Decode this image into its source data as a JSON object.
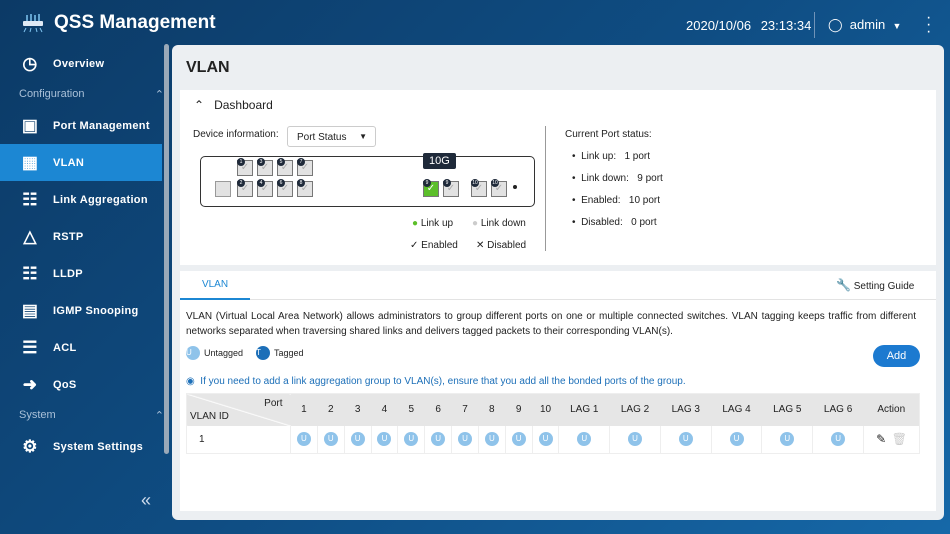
{
  "header": {
    "title": "QSS Management",
    "date": "2020/10/06",
    "time": "23:13:34",
    "user": "admin"
  },
  "sidebar": {
    "overview": "Overview",
    "section_config": "Configuration",
    "items": [
      {
        "label": "Port Management",
        "icon": "port-icon"
      },
      {
        "label": "VLAN",
        "icon": "vlan-icon",
        "active": true
      },
      {
        "label": "Link Aggregation",
        "icon": "link-aggregation-icon"
      },
      {
        "label": "RSTP",
        "icon": "rstp-icon"
      },
      {
        "label": "LLDP",
        "icon": "lldp-icon"
      },
      {
        "label": "IGMP Snooping",
        "icon": "igmp-icon"
      },
      {
        "label": "ACL",
        "icon": "acl-icon"
      },
      {
        "label": "QoS",
        "icon": "qos-icon"
      }
    ],
    "section_system": "System",
    "system_settings": "System Settings"
  },
  "page": {
    "title": "VLAN"
  },
  "dashboard": {
    "title": "Dashboard",
    "device_info_label": "Device information:",
    "device_info_value": "Port Status",
    "tooltip": "10G",
    "ports_top": [
      "1",
      "3",
      "5",
      "7"
    ],
    "ports_bottom": [
      "2",
      "4",
      "6",
      "8"
    ],
    "ports_right": [
      "9",
      "9",
      "10",
      "10"
    ],
    "legend": {
      "link_up": "Link up",
      "link_down": "Link down",
      "enabled": "Enabled",
      "disabled": "Disabled"
    },
    "status_title": "Current Port status:",
    "status": [
      {
        "label": "Link up:",
        "value": "1 port"
      },
      {
        "label": "Link down:",
        "value": "9 port"
      },
      {
        "label": "Enabled:",
        "value": "10 port"
      },
      {
        "label": "Disabled:",
        "value": "0 port"
      }
    ],
    "colors": {
      "link_up": "#5cbf2a",
      "link_down": "#cccccc"
    }
  },
  "vlan": {
    "tab": "VLAN",
    "setting_guide": "Setting Guide",
    "description": "VLAN (Virtual Local Area Network) allows administrators to group different ports on one or multiple connected switches. VLAN tagging keeps traffic from different networks separated when traversing shared links and delivers tagged packets to their corresponding VLAN(s).",
    "untagged": "Untagged",
    "tagged": "Tagged",
    "untagged_letter": "U",
    "tagged_letter": "T",
    "add": "Add",
    "note": "If you need to add a link aggregation group to VLAN(s), ensure that you add all the bonded ports of the group.",
    "table": {
      "corner_port": "Port",
      "corner_vlan": "VLAN ID",
      "columns": [
        "1",
        "2",
        "3",
        "4",
        "5",
        "6",
        "7",
        "8",
        "9",
        "10",
        "LAG 1",
        "LAG 2",
        "LAG 3",
        "LAG 4",
        "LAG 5",
        "LAG 6"
      ],
      "action": "Action",
      "rows": [
        {
          "id": "1",
          "cells": [
            "U",
            "U",
            "U",
            "U",
            "U",
            "U",
            "U",
            "U",
            "U",
            "U",
            "U",
            "U",
            "U",
            "U",
            "U",
            "U"
          ]
        }
      ]
    }
  },
  "colors": {
    "accent": "#1c87d3",
    "header_bg": "#0c3a66"
  }
}
